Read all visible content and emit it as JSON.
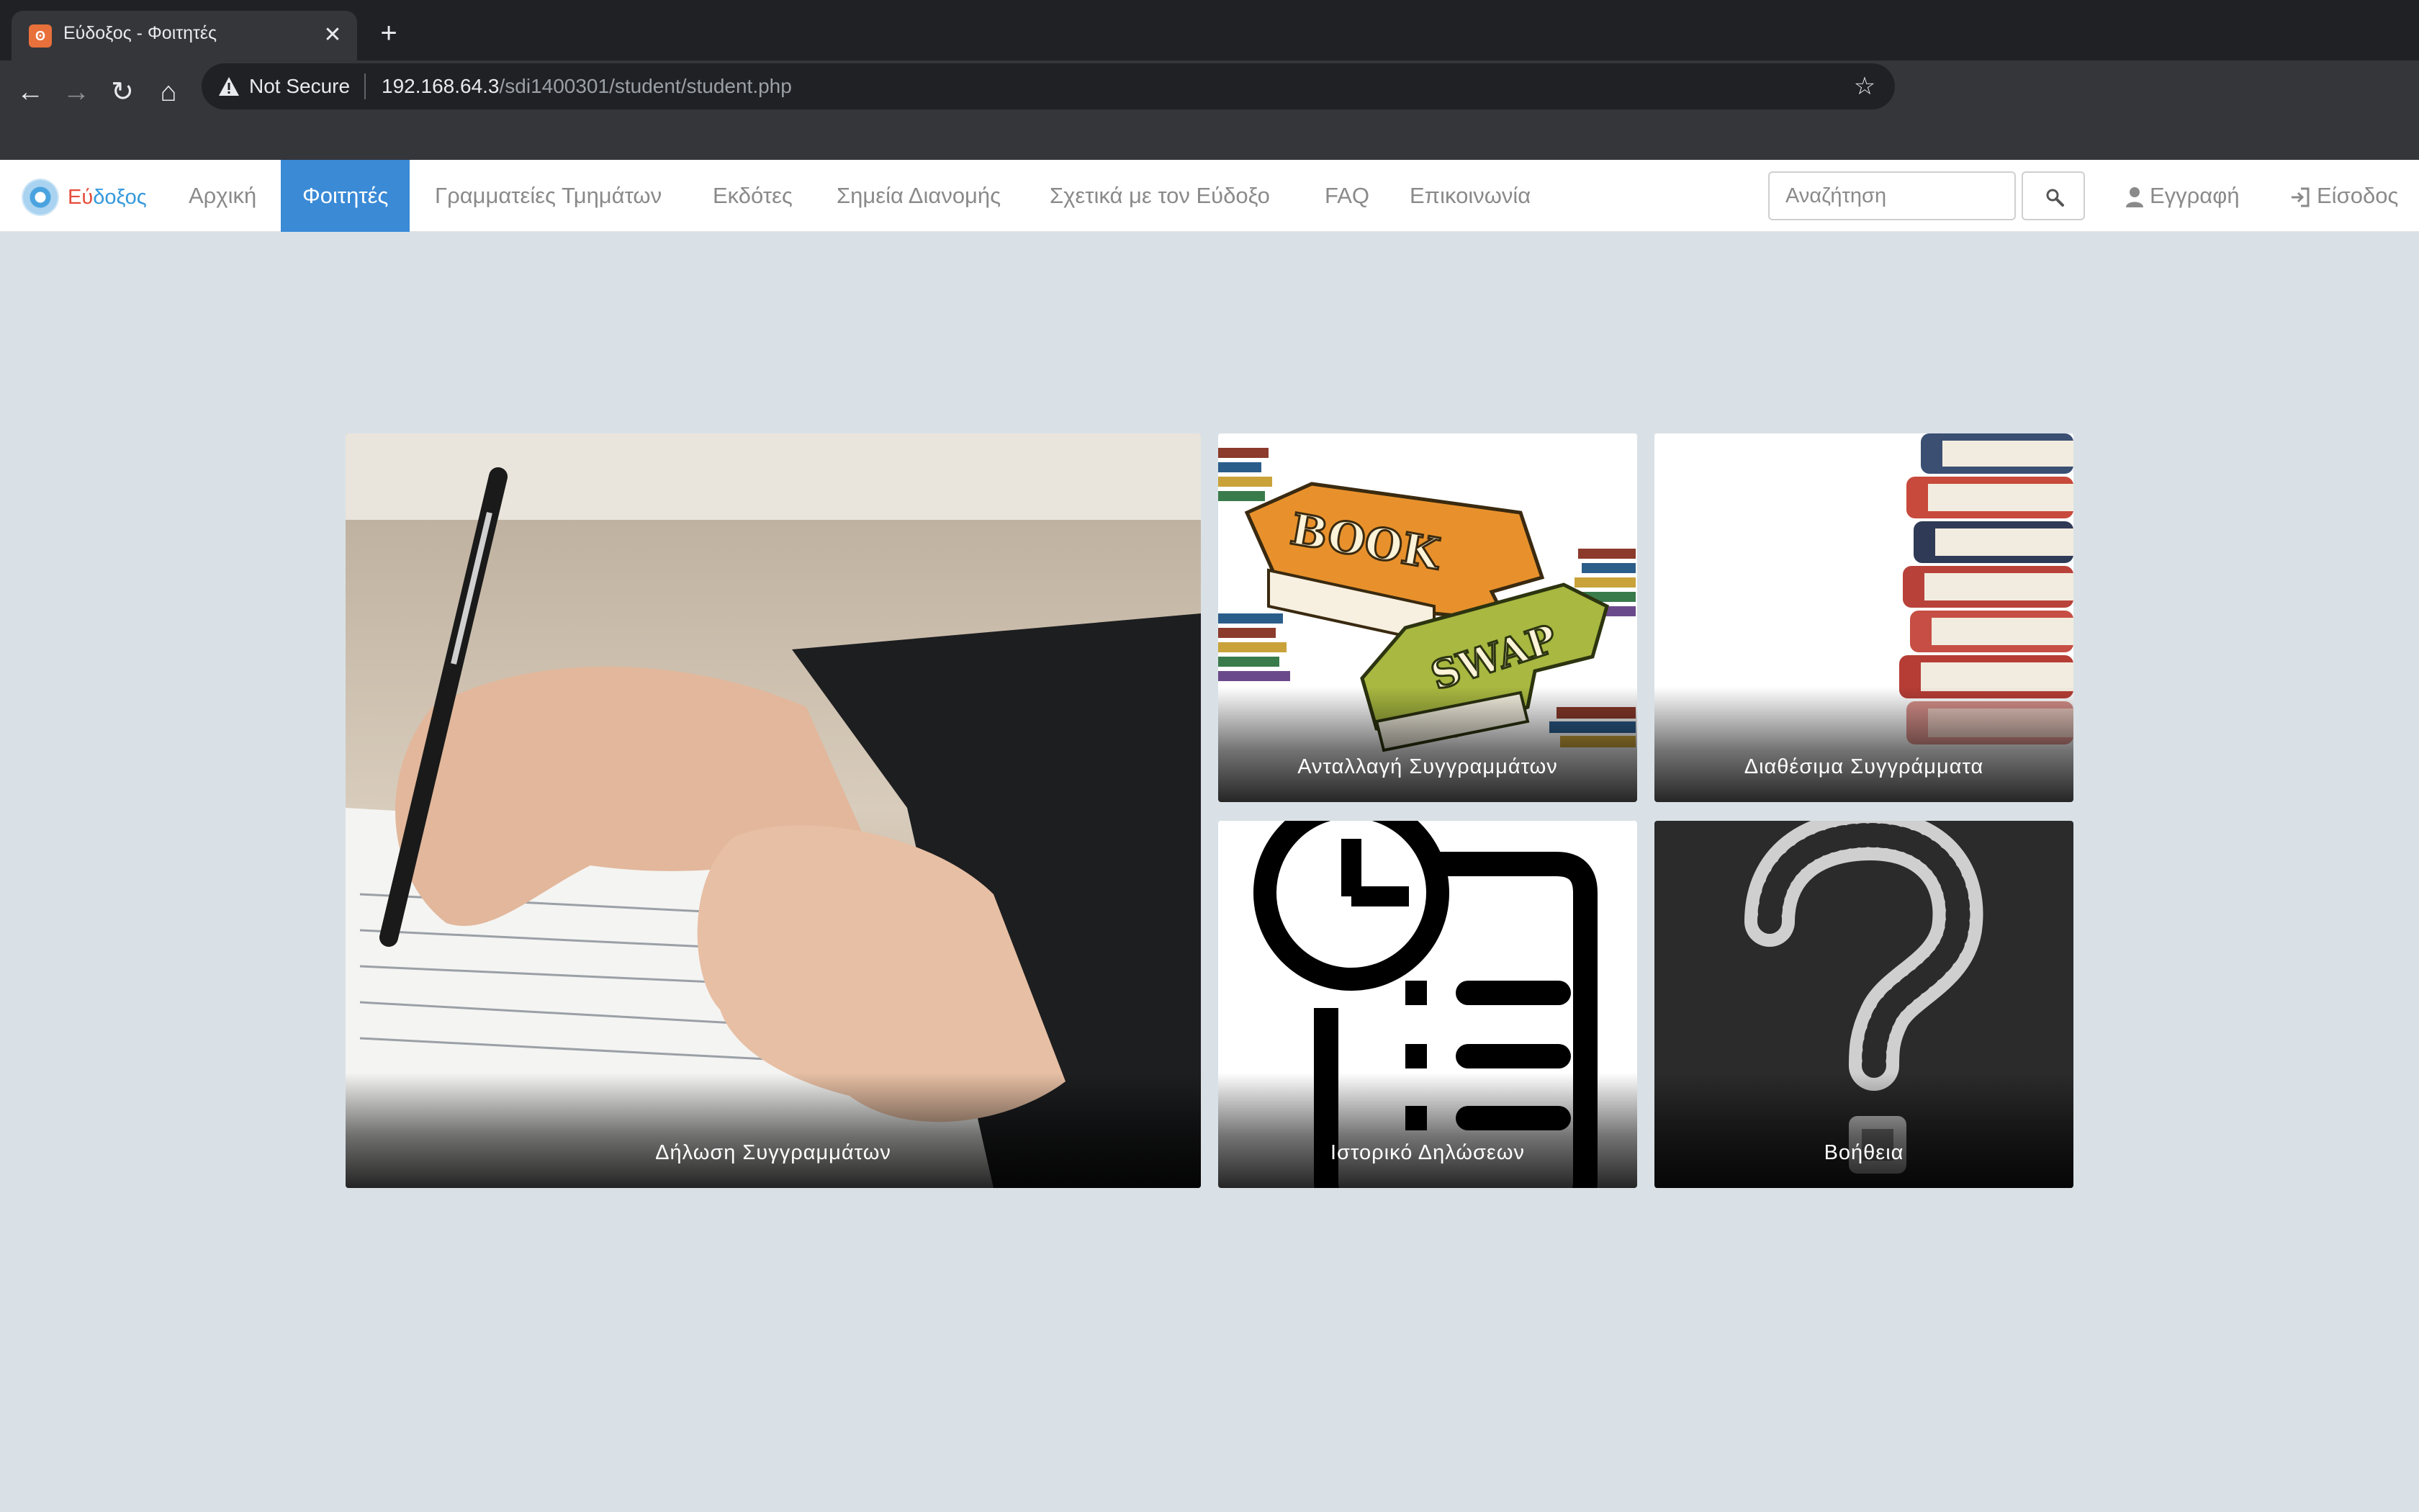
{
  "browser": {
    "tab_title": "Εύδοξος - Φοιτητές",
    "security_label": "Not Secure",
    "url_host": "192.168.64.3",
    "url_path": "/sdi1400301/student/student.php"
  },
  "navbar": {
    "brand_part1": "Εύ",
    "brand_part2": "δοξος",
    "items": [
      {
        "label": "Αρχική",
        "active": false
      },
      {
        "label": "Φοιτητές",
        "active": true
      },
      {
        "label": "Γραμματείες Τμημάτων",
        "active": false
      },
      {
        "label": "Εκδότες",
        "active": false
      },
      {
        "label": "Σημεία Διανομής",
        "active": false
      },
      {
        "label": "Σχετικά με τον Εύδοξο",
        "active": false
      },
      {
        "label": "FAQ",
        "active": false
      },
      {
        "label": "Επικοινωνία",
        "active": false
      }
    ],
    "search_placeholder": "Αναζήτηση",
    "register_label": "Εγγραφή",
    "login_label": "Είσοδος"
  },
  "tiles": {
    "dilosi": "Δήλωση Συγγραμμάτων",
    "antallagi": "Ανταλλαγή Συγγραμμάτων",
    "diathesima": "Διαθέσιμα Συγγράμματα",
    "istoriko": "Ιστορικό Δηλώσεων",
    "voitheia": "Βοήθεια",
    "book_word": "BOOK",
    "swap_word": "SWAP"
  },
  "colors": {
    "active_nav": "#3a8ad6",
    "page_background": "#d9e1e6",
    "brand_red": "#e74c3c",
    "brand_blue": "#3498db"
  }
}
